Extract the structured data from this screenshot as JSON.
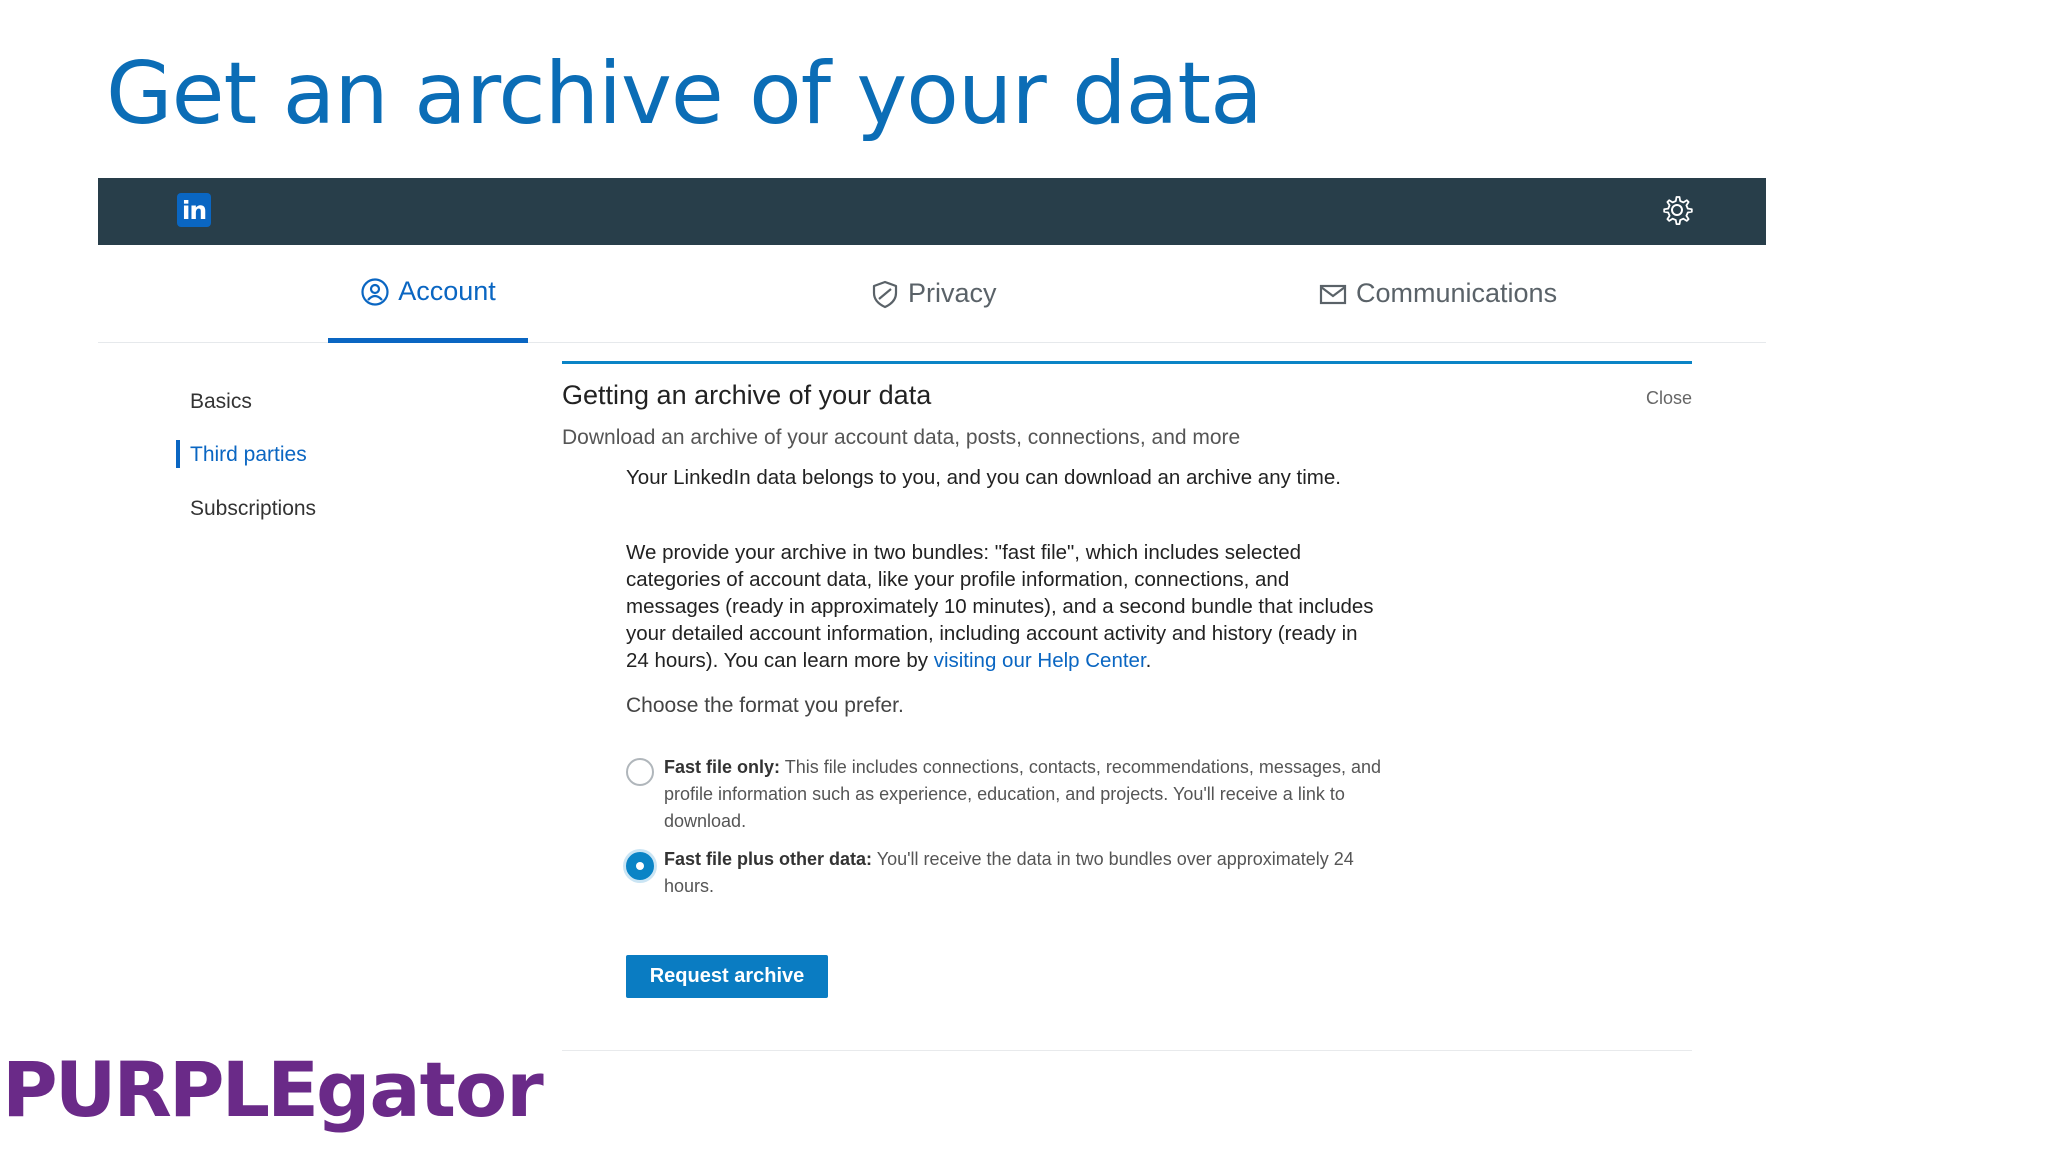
{
  "slide": {
    "title": "Get an archive of your data"
  },
  "linkedin": {
    "logo_text": "in",
    "tabs": [
      {
        "label": "Account",
        "icon": "account-icon",
        "active": true
      },
      {
        "label": "Privacy",
        "icon": "shield-icon",
        "active": false
      },
      {
        "label": "Communications",
        "icon": "envelope-icon",
        "active": false
      }
    ],
    "sidebar": [
      {
        "label": "Basics",
        "active": false
      },
      {
        "label": "Third parties",
        "active": true
      },
      {
        "label": "Subscriptions",
        "active": false
      }
    ],
    "panel": {
      "title": "Getting an archive of your data",
      "close_label": "Close",
      "subtitle": "Download an archive of your account data, posts, connections, and more",
      "para1": "Your LinkedIn data belongs to you, and you can download an archive any time.",
      "para2": "We provide your archive in two bundles: \"fast file\", which includes selected categories of account data, like your profile information, connections, and messages (ready in approximately 10 minutes), and a second bundle that includes your detailed account information, including account activity and history (ready in 24 hours). You can learn more by",
      "help_link": "visiting our Help Center",
      "help_link_end": ".",
      "choose_label": "Choose the format you prefer.",
      "options": [
        {
          "title": "Fast file only:",
          "desc": "This file includes connections, contacts, recommendations, messages, and profile information such as experience, education, and projects. You'll receive a link to download.",
          "selected": false
        },
        {
          "title": "Fast file plus other data:",
          "desc": "You'll receive the data in two bundles over approximately 24 hours.",
          "selected": true
        }
      ],
      "request_button": "Request archive"
    }
  },
  "brand": {
    "purple": "PURPLE",
    "gator": "gator",
    "color": "#6a2a88"
  },
  "colors": {
    "title_blue": "#0b6db6",
    "topbar": "#283e4a",
    "linkedin_blue": "#0a66c2"
  }
}
